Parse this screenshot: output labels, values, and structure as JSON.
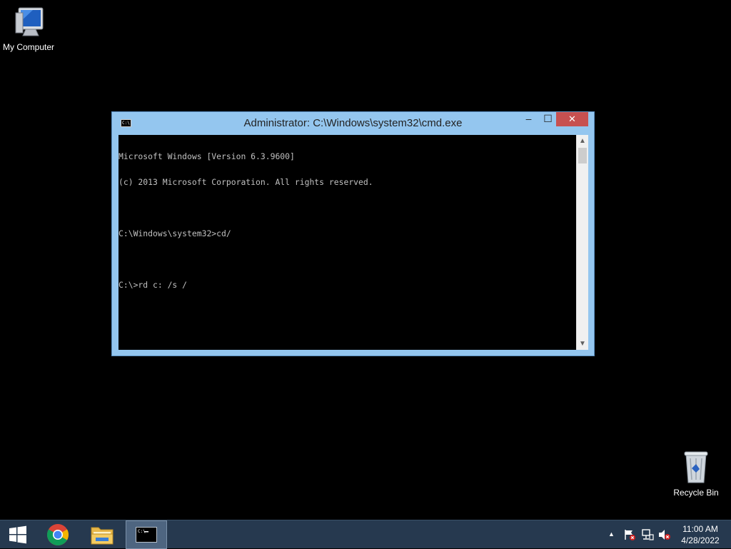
{
  "desktop": {
    "icons": [
      {
        "label": "My Computer",
        "icon": "computer-icon"
      },
      {
        "label": "Recycle Bin",
        "icon": "recycle-bin-icon"
      }
    ]
  },
  "window": {
    "title": "Administrator: C:\\Windows\\system32\\cmd.exe",
    "icon_text": "C:\\",
    "minimize": "–",
    "maximize": "☐",
    "close": "✕",
    "console_lines": [
      "Microsoft Windows [Version 6.3.9600]",
      "(c) 2013 Microsoft Corporation. All rights reserved.",
      "",
      "C:\\Windows\\system32>cd/",
      "",
      "C:\\>rd c: /s /"
    ],
    "text_color": "#c0c0c0",
    "frame_color": "#94c6ef",
    "close_color": "#c75050"
  },
  "taskbar": {
    "items": [
      {
        "name": "start",
        "icon": "windows-logo-icon"
      },
      {
        "name": "chrome",
        "icon": "chrome-icon"
      },
      {
        "name": "file-explorer",
        "icon": "folder-icon"
      },
      {
        "name": "command-prompt",
        "icon": "cmd-icon",
        "active": true
      }
    ],
    "tray": {
      "show_hidden": "▲",
      "icons": [
        "action-center-flag-icon",
        "network-icon",
        "volume-muted-icon"
      ]
    },
    "clock": {
      "time": "11:00 AM",
      "date": "4/28/2022"
    },
    "background": "#26394f"
  }
}
